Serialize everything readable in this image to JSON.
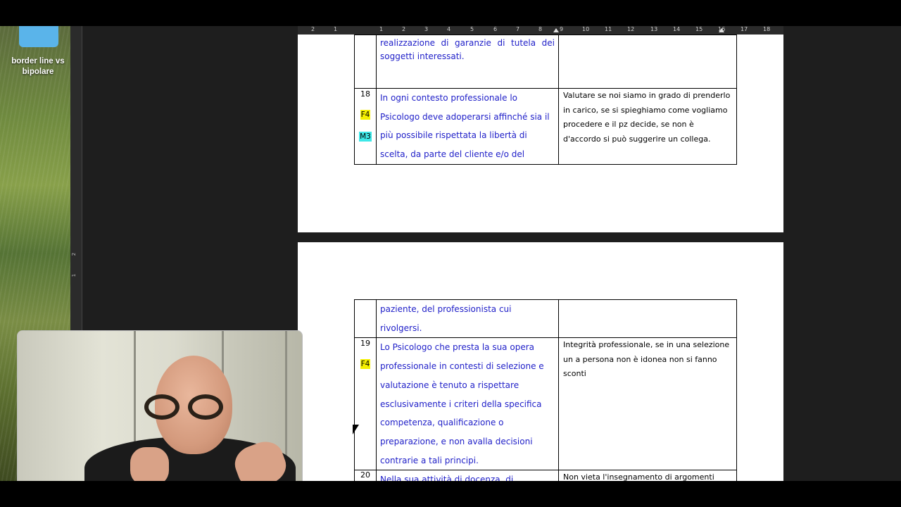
{
  "desktop": {
    "folder_label": "border line vs bipolare"
  },
  "ruler": {
    "numbers": [
      "2",
      "1",
      "1",
      "2",
      "3",
      "4",
      "5",
      "6",
      "7",
      "8",
      "9",
      "10",
      "11",
      "12",
      "13",
      "14",
      "15",
      "16",
      "17",
      "18"
    ]
  },
  "vruler": {
    "marks": [
      "2",
      "1"
    ]
  },
  "page1": {
    "rows": [
      {
        "num": "",
        "codes": [],
        "article": "realizzazione di garanzie di tutela dei soggetti interessati.",
        "note": ""
      },
      {
        "num": "18",
        "codes": [
          {
            "label": "F4",
            "color": "#f4f000"
          },
          {
            "label": "M3",
            "color": "#3ee8e8"
          }
        ],
        "article": "In ogni contesto professionale lo Psicologo deve adoperarsi affinché sia il più possibile rispettata la libertà di scelta, da parte del cliente e/o del",
        "note": "Valutare se noi siamo in grado di prenderlo in carico, se si spieghiamo come vogliamo procedere e il pz decide, se non è d'accordo si può suggerire un collega."
      }
    ]
  },
  "page2": {
    "rows": [
      {
        "num": "",
        "codes": [],
        "article": "paziente, del professionista cui rivolgersi.",
        "note": ""
      },
      {
        "num": "19",
        "codes": [
          {
            "label": "F4",
            "color": "#f4f000"
          }
        ],
        "article": "Lo Psicologo che presta la sua opera professionale in contesti di selezione e valutazione è tenuto a rispettare esclusivamente i criteri della specifica competenza, qualificazione o preparazione, e non avalla decisioni contrarie a tali principi.",
        "note": "Integrità professionale, se in una selezione un a persona non è idonea non si fanno sconti"
      },
      {
        "num": "20",
        "codes": [],
        "article": "Nella sua attività di docenza, di",
        "note": "Non vieta l'insegnamento di argomenti"
      }
    ]
  }
}
